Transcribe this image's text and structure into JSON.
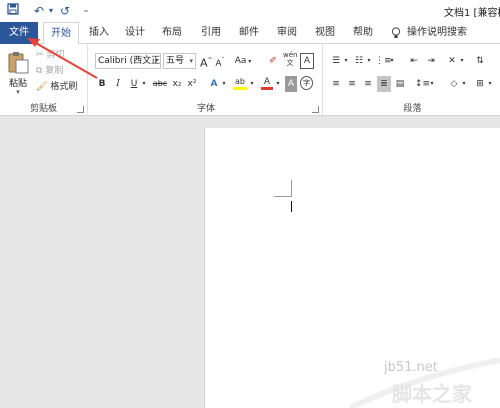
{
  "quick_access": {
    "save_icon": "save-icon",
    "undo_glyph": "↶",
    "redo_glyph": "↺",
    "customize_glyph": "₌"
  },
  "title": "文档1 [兼容模",
  "tabs": [
    "文件",
    "开始",
    "插入",
    "设计",
    "布局",
    "引用",
    "邮件",
    "审阅",
    "视图",
    "帮助"
  ],
  "tell_me": "操作说明搜索",
  "clipboard": {
    "paste_label": "粘贴",
    "cut_label": "剪切",
    "copy_label": "复制",
    "format_painter_label": "格式刷",
    "group_label": "剪贴板"
  },
  "font": {
    "font_name": "Calibri (西文正",
    "font_size": "五号",
    "group_label": "字体",
    "grow_label": "A",
    "shrink_label": "A",
    "case_label": "Aa",
    "bold": "B",
    "italic": "I",
    "underline": "U",
    "strike": "abc",
    "subscript": "x₂",
    "superscript": "x²",
    "highlight_label": "ab",
    "font_color_label": "A",
    "char_shading_label": "A",
    "enclose_label": "字",
    "phonetic_label": "wén",
    "border_label": "A"
  },
  "paragraph": {
    "group_label": "段落"
  },
  "colors": {
    "file_tab": "#2b579a",
    "accent": "#2b579a",
    "arrow": "#e8413a",
    "highlight": "#ffff00",
    "font_red": "#e23a2b"
  },
  "watermark": {
    "site": "jb51.net",
    "name": "脚本之家"
  }
}
